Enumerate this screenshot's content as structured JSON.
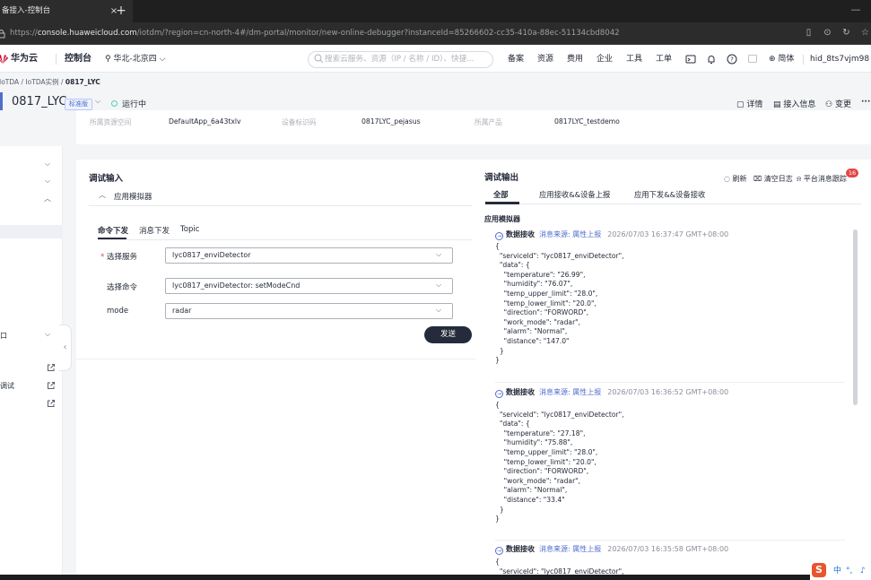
{
  "browser": {
    "tab_title": "备接入-控制台",
    "tab_close": "×",
    "new_tab": "+",
    "minimize": "—",
    "url_scheme": "https://",
    "url_host": "console.huaweicloud.com",
    "url_path": "/iotdm/?region=cn-north-4#/dm-portal/monitor/new-online-debugger?instanceId=85266602-cc35-410a-88ec-51134cbd8042"
  },
  "topnav": {
    "logo": "华为云",
    "console": "控制台",
    "region": "华北-北京四",
    "search_placeholder": "搜索云服务、资源（IP / 名称 / ID）、快捷...",
    "links": [
      "备案",
      "资源",
      "费用",
      "企业",
      "工具",
      "工单"
    ],
    "language": "简体",
    "user": "hid_8ts7vjm98"
  },
  "breadcrumb": {
    "items": [
      "IoTDA",
      "IoTDA实例"
    ],
    "sep": " / ",
    "current": "0817_LYC"
  },
  "title": {
    "name": "0817_LYC",
    "edition": "标准版",
    "status": "运行中",
    "actions": [
      "详情",
      "接入信息",
      "变更"
    ],
    "more": "···"
  },
  "info": {
    "space_label": "所属资源空间",
    "space_value": "DefaultApp_6a43txlv",
    "device_label": "设备标识码",
    "device_value": "0817LYC_pejasus",
    "product_label": "所属产品",
    "product_value": "0817LYC_testdemo"
  },
  "sidebar": {
    "item_a": "口",
    "item_b": "调试"
  },
  "input": {
    "title": "调试输入",
    "simulator": "应用模拟器",
    "tabs": [
      "命令下发",
      "消息下发",
      "Topic"
    ],
    "service_label": "选择服务",
    "required_mark": "*",
    "service_value": "lyc0817_enviDetector",
    "command_label": "选择命令",
    "command_value": "lyc0817_enviDetector: setModeCnd",
    "mode_label": "mode",
    "mode_value": "radar",
    "send": "发送"
  },
  "output": {
    "title": "调试输出",
    "refresh": "刷新",
    "clear": "清空日志",
    "platform": "平台消息跟踪",
    "badge": "16",
    "tabs": [
      "全部",
      "应用接收&&设备上报",
      "应用下发&&设备接收"
    ],
    "subtitle": "应用模拟器",
    "logs": [
      {
        "label": "数据接收",
        "source": "消息来源: 属性上报",
        "time": "2026/07/03 16:37:47 GMT+08:00",
        "body": "{\n  \"serviceId\": \"lyc0817_enviDetector\",\n  \"data\": {\n    \"temperature\": \"26.99\",\n    \"humidity\": \"76.07\",\n    \"temp_upper_limit\": \"28.0\",\n    \"temp_lower_limit\": \"20.0\",\n    \"direction\": \"FORWORD\",\n    \"work_mode\": \"radar\",\n    \"alarm\": \"Normal\",\n    \"distance\": \"147.0\"\n  }\n}"
      },
      {
        "label": "数据接收",
        "source": "消息来源: 属性上报",
        "time": "2026/07/03 16:36:52 GMT+08:00",
        "body": "{\n  \"serviceId\": \"lyc0817_enviDetector\",\n  \"data\": {\n    \"temperature\": \"27.18\",\n    \"humidity\": \"75.88\",\n    \"temp_upper_limit\": \"28.0\",\n    \"temp_lower_limit\": \"20.0\",\n    \"direction\": \"FORWORD\",\n    \"work_mode\": \"radar\",\n    \"alarm\": \"Normal\",\n    \"distance\": \"33.4\"\n  }\n}"
      },
      {
        "label": "数据接收",
        "source": "消息来源: 属性上报",
        "time": "2026/07/03 16:35:58 GMT+08:00",
        "body": "{\n  \"serviceId\": \"lyc0817_enviDetector\","
      }
    ]
  },
  "ime": {
    "logo": "S",
    "lang": "中"
  }
}
